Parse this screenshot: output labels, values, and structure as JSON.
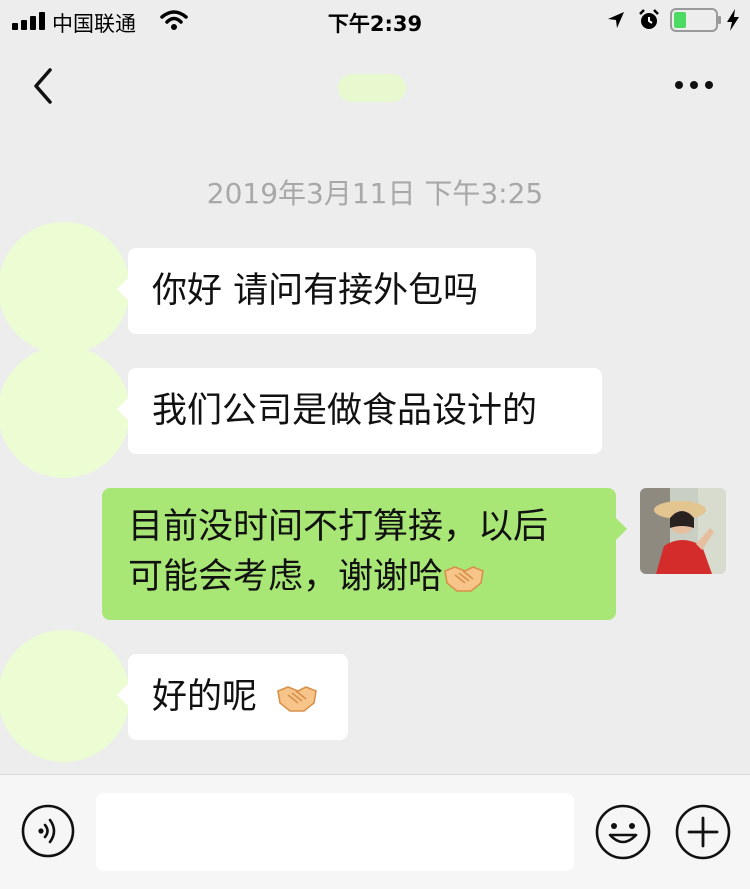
{
  "status_bar": {
    "carrier": "中国联通",
    "time": "下午2:39",
    "battery_level": 0.3
  },
  "chat": {
    "timestamp": "2019年3月11日 下午3:25",
    "messages": [
      {
        "side": "left",
        "text": "你好 请问有接外包吗"
      },
      {
        "side": "left",
        "text": "我们公司是做食品设计的"
      },
      {
        "side": "right",
        "line1": "目前没时间不打算接，以后",
        "line2": "可能会考虑，谢谢哈",
        "emoji": "handshake-emoji"
      },
      {
        "side": "left",
        "text": "好的呢",
        "emoji": "handshake-emoji"
      }
    ]
  },
  "colors": {
    "background": "#ededed",
    "incoming_bubble": "#ffffff",
    "outgoing_bubble": "#a8e775",
    "timestamp": "#a8a8a8",
    "avatar_placeholder": "#ecfcd3"
  },
  "icons": [
    "signal-icon",
    "wifi-icon",
    "location-icon",
    "alarm-icon",
    "battery-icon",
    "charging-icon",
    "back-chevron-icon",
    "more-icon",
    "voice-icon",
    "emoji-icon",
    "plus-icon"
  ]
}
